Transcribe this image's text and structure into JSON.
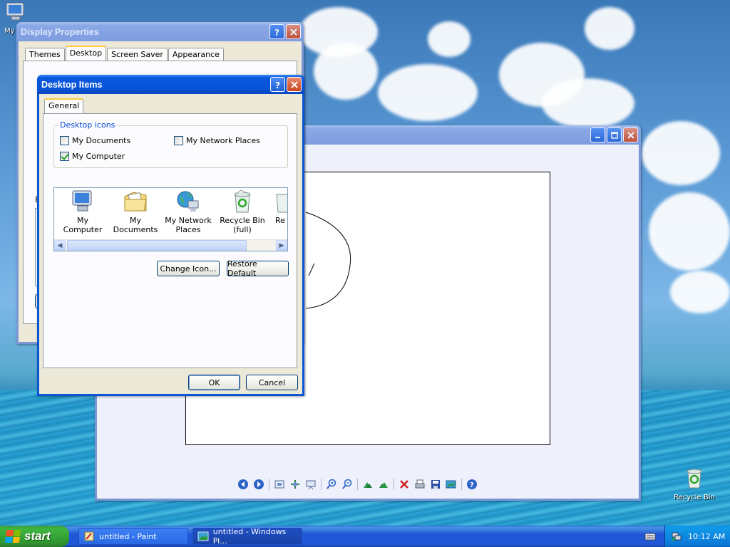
{
  "desktop": {
    "icons": [
      {
        "label": "My Computer",
        "icon": "my-computer-icon"
      },
      {
        "label": "Recycle Bin",
        "icon": "recycle-bin-icon"
      }
    ]
  },
  "display_properties": {
    "title": "Display Properties",
    "tabs": [
      "Themes",
      "Desktop",
      "Screen Saver",
      "Appearance"
    ],
    "selected_tab": "Desktop",
    "partial_label": "B"
  },
  "desktop_items": {
    "title": "Desktop Items",
    "tabs": [
      "General"
    ],
    "group_label": "Desktop icons",
    "checkboxes": [
      {
        "label": "My Documents",
        "checked": false
      },
      {
        "label": "My Network Places",
        "checked": false
      },
      {
        "label": "My Computer",
        "checked": true
      }
    ],
    "icon_list": [
      {
        "label": "My Computer",
        "icon": "my-computer-icon"
      },
      {
        "label": "My Documents",
        "icon": "my-documents-icon"
      },
      {
        "label": "My Network Places",
        "icon": "network-places-icon"
      },
      {
        "label": "Recycle Bin (full)",
        "icon": "recycle-bin-full-icon"
      },
      {
        "label": "Re",
        "icon": "recycle-bin-empty-icon"
      }
    ],
    "change_icon_label": "Change Icon...",
    "restore_default_label": "Restore Default",
    "ok_label": "OK",
    "cancel_label": "Cancel"
  },
  "viewer": {
    "toolbar_icons": [
      "previous-image-icon",
      "next-image-icon",
      "best-fit-icon",
      "actual-size-icon",
      "slideshow-icon",
      "zoom-in-icon",
      "zoom-out-icon",
      "rotate-clockwise-icon",
      "rotate-counterclockwise-icon",
      "delete-icon",
      "print-icon",
      "save-icon",
      "edit-icon",
      "help-icon"
    ]
  },
  "taskbar": {
    "start_label": "start",
    "tasks": [
      {
        "label": "untitled - Paint",
        "icon": "paint-icon"
      },
      {
        "label": "untitled - Windows Pi...",
        "icon": "picture-viewer-icon"
      }
    ],
    "clock": "10:12 AM"
  },
  "colors": {
    "title_active": "#0a58e0",
    "title_inactive": "#7e9de0",
    "dialog_bg": "#ece9d8",
    "taskbar": "#2157d7",
    "start_green": "#3eb53e"
  }
}
